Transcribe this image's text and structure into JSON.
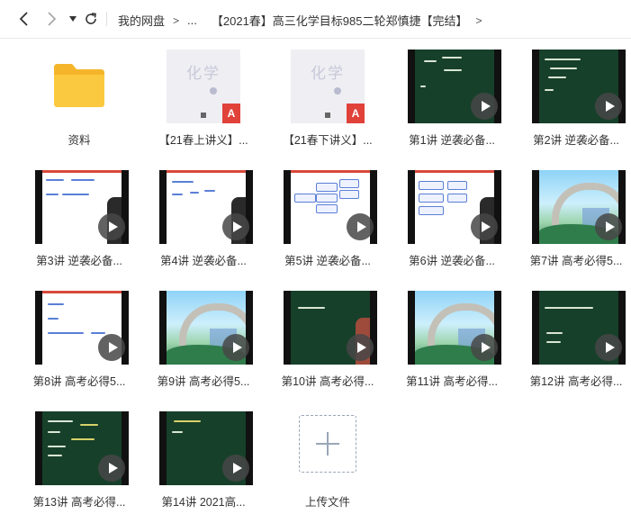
{
  "toolbar": {
    "back_label": "<",
    "forward_label": ">",
    "dropdown_label": "▾",
    "crumbs": [
      "我的网盘",
      "...",
      "【2021春】高三化学目标985二轮郑慎捷【完结】"
    ],
    "separator": ">"
  },
  "pdf_thumb": {
    "title": "化学",
    "badge": "A"
  },
  "items": [
    {
      "label": "资料",
      "type": "folder"
    },
    {
      "label": "【21春上讲义】...",
      "type": "pdf"
    },
    {
      "label": "【21春下讲义】...",
      "type": "pdf"
    },
    {
      "label": "第1讲 逆袭必备...",
      "type": "video"
    },
    {
      "label": "第2讲 逆袭必备...",
      "type": "video"
    },
    {
      "label": "第3讲 逆袭必备...",
      "type": "video"
    },
    {
      "label": "第4讲 逆袭必备...",
      "type": "video"
    },
    {
      "label": "第5讲 逆袭必备...",
      "type": "video"
    },
    {
      "label": "第6讲 逆袭必备...",
      "type": "video"
    },
    {
      "label": "第7讲 高考必得5...",
      "type": "video"
    },
    {
      "label": "第8讲 高考必得5...",
      "type": "video"
    },
    {
      "label": "第9讲 高考必得5...",
      "type": "video"
    },
    {
      "label": "第10讲 高考必得...",
      "type": "video"
    },
    {
      "label": "第11讲 高考必得...",
      "type": "video"
    },
    {
      "label": "第12讲 高考必得...",
      "type": "video"
    },
    {
      "label": "第13讲 高考必得...",
      "type": "video"
    },
    {
      "label": "第14讲 2021高...",
      "type": "video"
    },
    {
      "label": "上传文件",
      "type": "upload"
    }
  ],
  "colors": {
    "folder": "#f9c43a",
    "pdf_badge": "#e0423a",
    "board_green": "#17402a"
  }
}
